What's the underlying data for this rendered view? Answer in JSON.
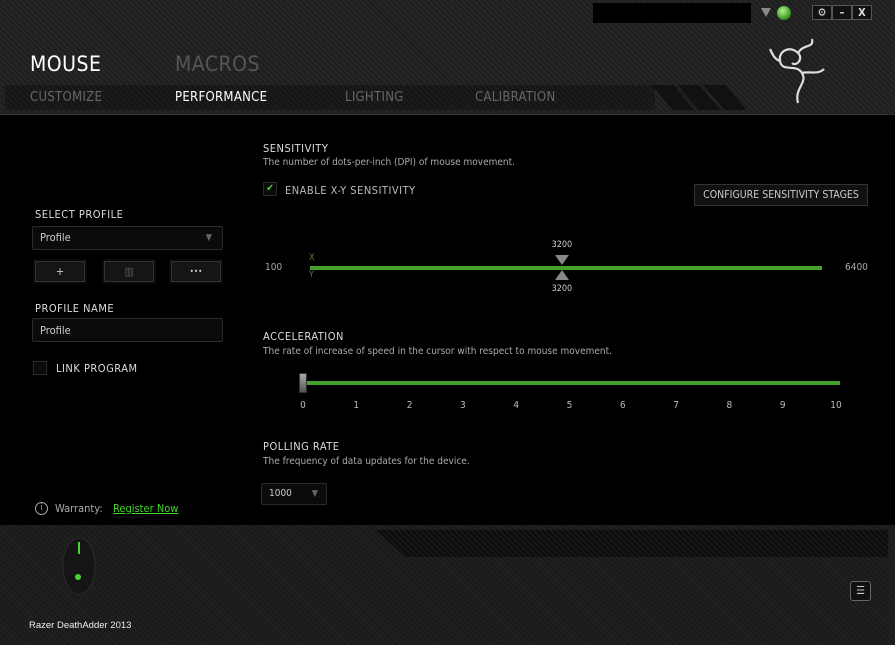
{
  "header": {
    "tabs": [
      {
        "label": "MOUSE",
        "active": true
      },
      {
        "label": "MACROS",
        "active": false
      }
    ],
    "subtabs": [
      {
        "label": "CUSTOMIZE"
      },
      {
        "label": "PERFORMANCE",
        "active": true
      },
      {
        "label": "LIGHTING"
      },
      {
        "label": "CALIBRATION"
      }
    ],
    "window_buttons": {
      "settings_icon": "gear-icon",
      "minimize": "–",
      "close": "X"
    }
  },
  "sidebar": {
    "select_profile_label": "SELECT PROFILE",
    "profile_value": "Profile",
    "add": "+",
    "delete_icon": "trash-icon",
    "more": "•••",
    "profile_name_label": "PROFILE NAME",
    "profile_name_value": "Profile",
    "link_program": "LINK PROGRAM",
    "warranty_label": "Warranty:",
    "register_link": "Register Now"
  },
  "sensitivity": {
    "title": "SENSITIVITY",
    "desc": "The number of dots-per-inch (DPI) of mouse movement.",
    "enable_xy": "ENABLE X-Y SENSITIVITY",
    "enable_xy_checked": true,
    "configure_button": "CONFIGURE SENSITIVITY STAGES",
    "min": "100",
    "max": "6400",
    "x_label": "X",
    "y_label": "Y",
    "x_value": "3200",
    "y_value": "3200"
  },
  "acceleration": {
    "title": "ACCELERATION",
    "desc": "The rate of increase of speed in the cursor with respect to mouse movement.",
    "value": 0,
    "ticks": [
      "0",
      "1",
      "2",
      "3",
      "4",
      "5",
      "6",
      "7",
      "8",
      "9",
      "10"
    ]
  },
  "polling": {
    "title": "POLLING RATE",
    "desc": "The frequency of data updates for the device.",
    "value": "1000"
  },
  "footer": {
    "device_name": "Razer DeathAdder 2013"
  },
  "colors": {
    "accent": "#44a12b",
    "link": "#44d62c"
  }
}
